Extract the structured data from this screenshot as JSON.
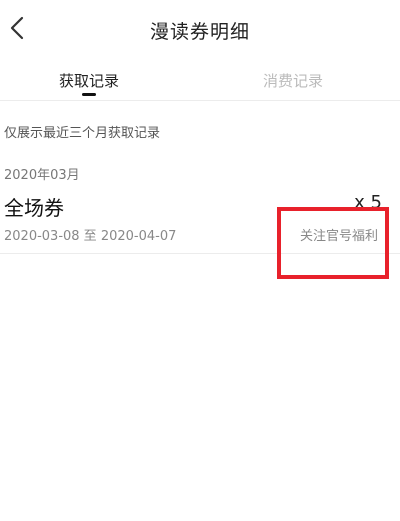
{
  "header": {
    "title": "漫读券明细",
    "back_icon": "chevron-left-icon"
  },
  "tabs": [
    {
      "label": "获取记录",
      "active": true
    },
    {
      "label": "消费记录",
      "active": false
    }
  ],
  "notice": "仅展示最近三个月获取记录",
  "records": {
    "month": "2020年03月",
    "items": [
      {
        "name": "全场券",
        "count": "x 5",
        "dates": "2020-03-08 至 2020-04-07",
        "source": "关注官号福利"
      }
    ]
  },
  "colors": {
    "highlight": "#e8212b",
    "inactive_tab": "#bbbbbb"
  }
}
